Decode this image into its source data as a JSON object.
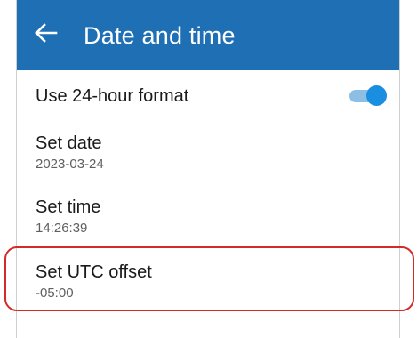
{
  "app_bar": {
    "title": "Date and time",
    "back_icon": "arrow-left-icon",
    "color": "#1f6fb5"
  },
  "settings": {
    "use_24_hour": {
      "label": "Use 24-hour format",
      "enabled": true
    },
    "set_date": {
      "label": "Set date",
      "value": "2023-03-24"
    },
    "set_time": {
      "label": "Set time",
      "value": "14:26:39"
    },
    "set_utc_offset": {
      "label": "Set UTC offset",
      "value": "-05:00"
    }
  },
  "colors": {
    "toggle_thumb": "#1a8ee0",
    "toggle_track": "#8cbfe3",
    "highlight": "#d42a2a"
  }
}
